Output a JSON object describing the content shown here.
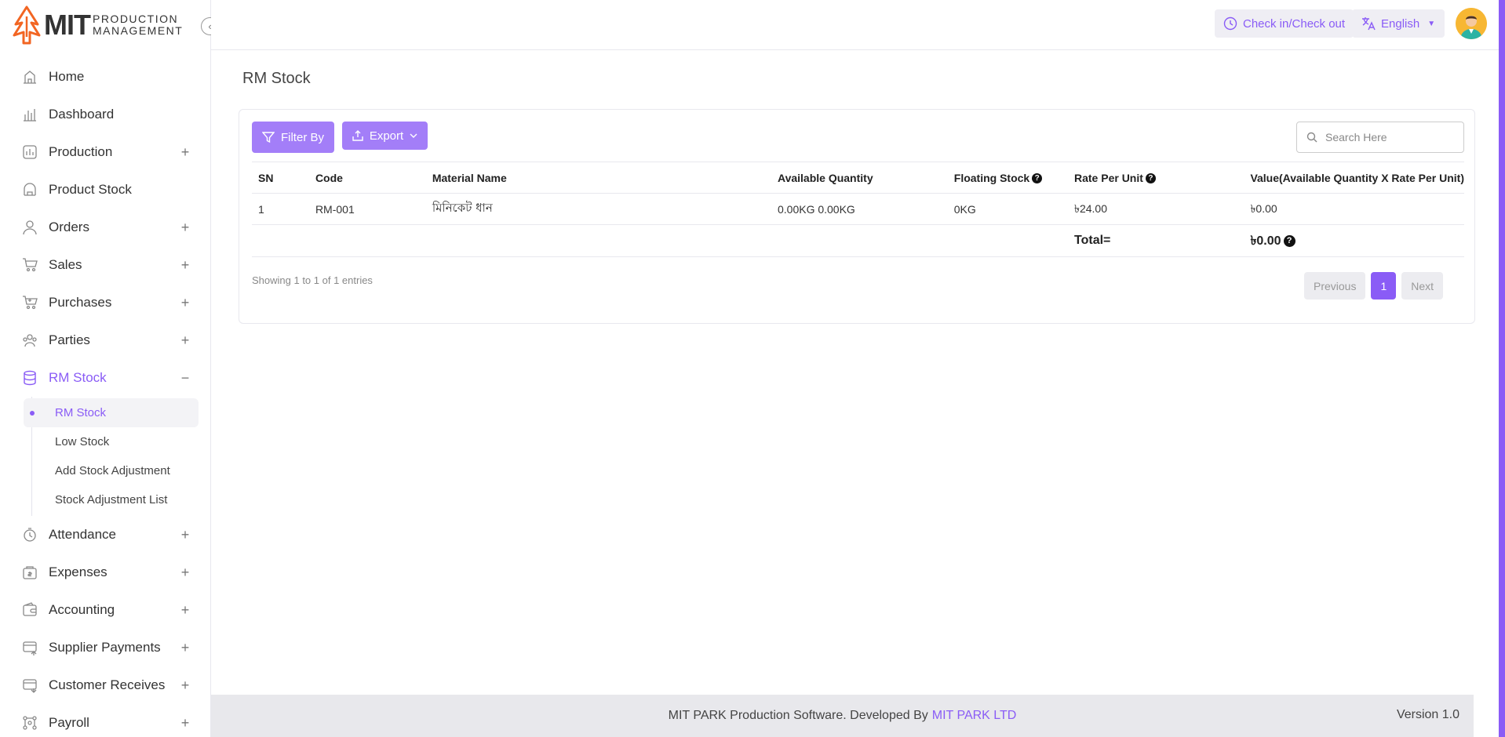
{
  "brand": {
    "logo_mark": "MIT",
    "logo_line1": "PRODUCTION",
    "logo_line2": "MANAGEMENT"
  },
  "topbar": {
    "check_label": "Check in/Check out",
    "language": "English"
  },
  "sidebar": {
    "items": [
      {
        "label": "Home",
        "icon": "home-icon"
      },
      {
        "label": "Dashboard",
        "icon": "dashboard-icon"
      },
      {
        "label": "Production",
        "icon": "production-icon",
        "toggle": "+"
      },
      {
        "label": "Product Stock",
        "icon": "product-stock-icon"
      },
      {
        "label": "Orders",
        "icon": "orders-icon",
        "toggle": "+"
      },
      {
        "label": "Sales",
        "icon": "sales-icon",
        "toggle": "+"
      },
      {
        "label": "Purchases",
        "icon": "purchases-icon",
        "toggle": "+"
      },
      {
        "label": "Parties",
        "icon": "parties-icon",
        "toggle": "+"
      },
      {
        "label": "RM Stock",
        "icon": "rm-stock-icon",
        "toggle": "−"
      },
      {
        "label": "Attendance",
        "icon": "attendance-icon",
        "toggle": "+"
      },
      {
        "label": "Expenses",
        "icon": "expenses-icon",
        "toggle": "+"
      },
      {
        "label": "Accounting",
        "icon": "accounting-icon",
        "toggle": "+"
      },
      {
        "label": "Supplier Payments",
        "icon": "supplier-payments-icon",
        "toggle": "+"
      },
      {
        "label": "Customer Receives",
        "icon": "customer-receives-icon",
        "toggle": "+"
      },
      {
        "label": "Payroll",
        "icon": "payroll-icon",
        "toggle": "+"
      }
    ],
    "rm_sub": [
      "RM Stock",
      "Low Stock",
      "Add Stock Adjustment",
      "Stock Adjustment List"
    ]
  },
  "main": {
    "title": "RM Stock",
    "filter_label": "Filter By",
    "export_label": "Export",
    "search_placeholder": "Search Here",
    "columns": [
      "SN",
      "Code",
      "Material Name",
      "Available Quantity",
      "Floating Stock",
      "Rate Per Unit",
      "Value(Available Quantity X Rate Per Unit)"
    ],
    "rows": [
      {
        "sn": "1",
        "code": "RM-001",
        "name": "মিনিকেট ধান",
        "available": "0.00KG 0.00KG",
        "floating": "0KG",
        "rate": "৳24.00",
        "value": "৳0.00"
      }
    ],
    "total_label": "Total=",
    "total_value": "৳0.00",
    "showing": "Showing 1 to 1 of 1 entries",
    "pager": {
      "prev": "Previous",
      "current": "1",
      "next": "Next"
    }
  },
  "footer": {
    "text": "MIT PARK Production Software. Developed By",
    "link": "MIT PARK LTD",
    "version": "Version 1.0"
  },
  "colors": {
    "accent": "#8a5cf6",
    "button": "#a37ef8"
  }
}
